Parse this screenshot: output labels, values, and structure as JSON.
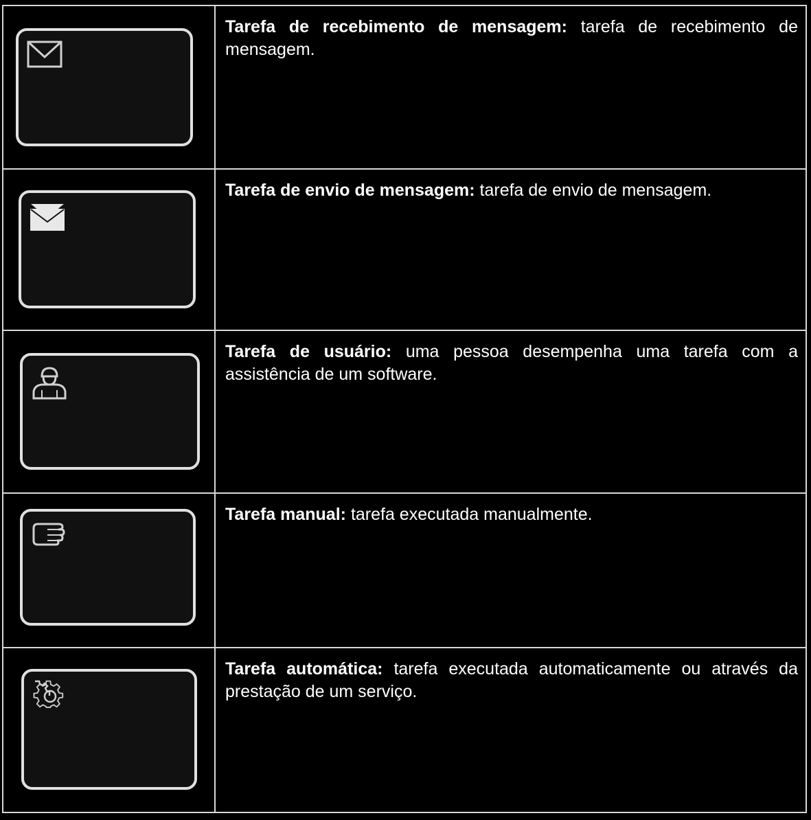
{
  "rows": [
    {
      "icon": "envelope-outline-icon",
      "title": "Tarefa de recebimento de mensagem:",
      "description": "tarefa de recebimento de mensagem."
    },
    {
      "icon": "envelope-filled-icon",
      "title": "Tarefa de envio de mensagem:",
      "description": "tarefa de envio de mensagem."
    },
    {
      "icon": "user-icon",
      "title": "Tarefa de usuário:",
      "description": "uma pessoa desempenha uma tarefa com a assistência de um software."
    },
    {
      "icon": "hand-icon",
      "title": "Tarefa manual:",
      "description": "tarefa executada manualmente."
    },
    {
      "icon": "gear-icon",
      "title": "Tarefa automática:",
      "description": "tarefa executada automaticamente ou através da prestação de um serviço."
    }
  ],
  "colors": {
    "background": "#000000",
    "border": "#d8d8d8",
    "task_outline": "#e0e0e0",
    "text": "#ffffff"
  }
}
